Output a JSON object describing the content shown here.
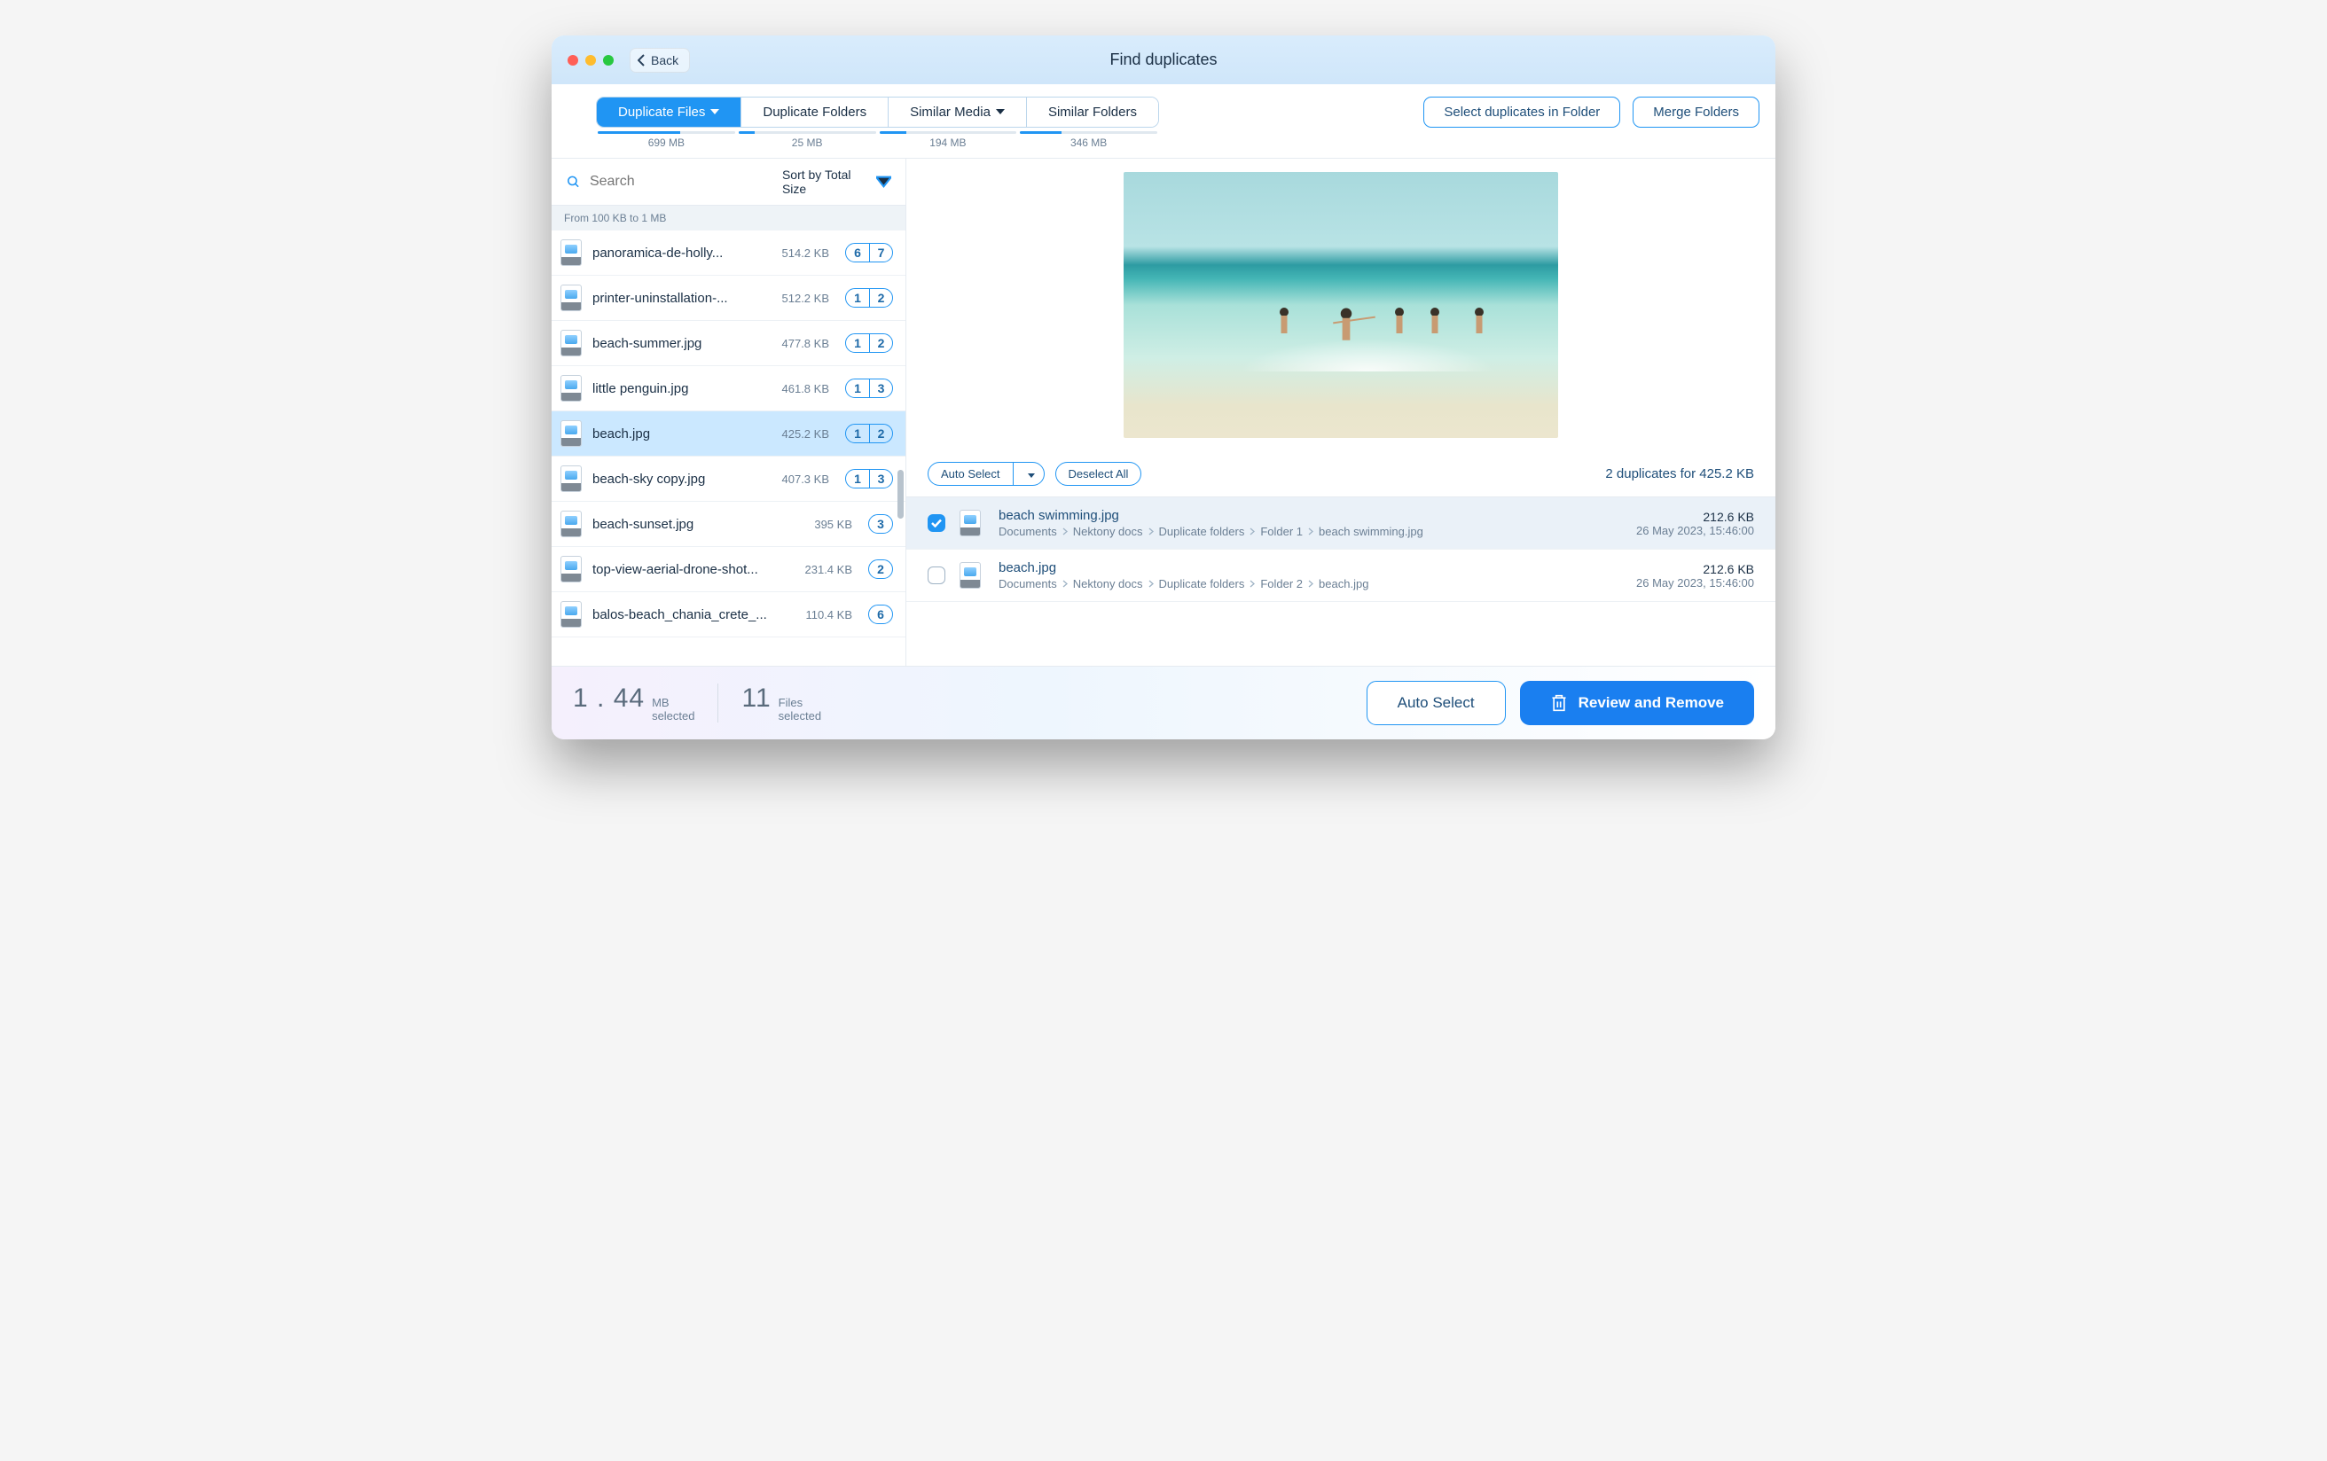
{
  "window_title": "Find duplicates",
  "back_label": "Back",
  "tabs": [
    {
      "label": "Duplicate Files",
      "size": "699 MB",
      "progress": 60,
      "active": true,
      "dropdown": true
    },
    {
      "label": "Duplicate Folders",
      "size": "25 MB",
      "progress": 12,
      "active": false,
      "dropdown": false
    },
    {
      "label": "Similar Media",
      "size": "194 MB",
      "progress": 20,
      "active": false,
      "dropdown": true
    },
    {
      "label": "Similar Folders",
      "size": "346 MB",
      "progress": 30,
      "active": false,
      "dropdown": false
    }
  ],
  "action_select_folder": "Select duplicates in Folder",
  "action_merge": "Merge Folders",
  "search_placeholder": "Search",
  "sort_label": "Sort by Total Size",
  "section_header": "From 100 KB to 1 MB",
  "files": [
    {
      "name": "panoramica-de-holly...",
      "size": "514.2 KB",
      "b1": "6",
      "b2": "7"
    },
    {
      "name": "printer-uninstallation-...",
      "size": "512.2 KB",
      "b1": "1",
      "b2": "2"
    },
    {
      "name": "beach-summer.jpg",
      "size": "477.8 KB",
      "b1": "1",
      "b2": "2"
    },
    {
      "name": "little penguin.jpg",
      "size": "461.8 KB",
      "b1": "1",
      "b2": "3"
    },
    {
      "name": "beach.jpg",
      "size": "425.2 KB",
      "b1": "1",
      "b2": "2",
      "selected": true
    },
    {
      "name": "beach-sky copy.jpg",
      "size": "407.3 KB",
      "b1": "1",
      "b2": "3"
    },
    {
      "name": "beach-sunset.jpg",
      "size": "395 KB",
      "b1": "3"
    },
    {
      "name": "top-view-aerial-drone-shot...",
      "size": "231.4 KB",
      "b1": "2"
    },
    {
      "name": "balos-beach_chania_crete_...",
      "size": "110.4 KB",
      "b1": "6"
    }
  ],
  "auto_select": "Auto Select",
  "deselect_all": "Deselect All",
  "dup_summary": "2 duplicates for 425.2 KB",
  "duplicates": [
    {
      "checked": true,
      "name": "beach swimming.jpg",
      "path": [
        "Documents",
        "Nektony docs",
        "Duplicate folders",
        "Folder 1",
        "beach swimming.jpg"
      ],
      "size": "212.6 KB",
      "date": "26 May 2023, 15:46:00"
    },
    {
      "checked": false,
      "name": "beach.jpg",
      "path": [
        "Documents",
        "Nektony docs",
        "Duplicate folders",
        "Folder 2",
        "beach.jpg"
      ],
      "size": "212.6 KB",
      "date": "26 May 2023, 15:46:00"
    }
  ],
  "footer": {
    "size_num": "1 . 44",
    "size_unit": "MB",
    "size_lbl": "selected",
    "files_num": "11",
    "files_unit": "Files",
    "files_lbl": "selected",
    "auto": "Auto Select",
    "review": "Review and Remove"
  }
}
